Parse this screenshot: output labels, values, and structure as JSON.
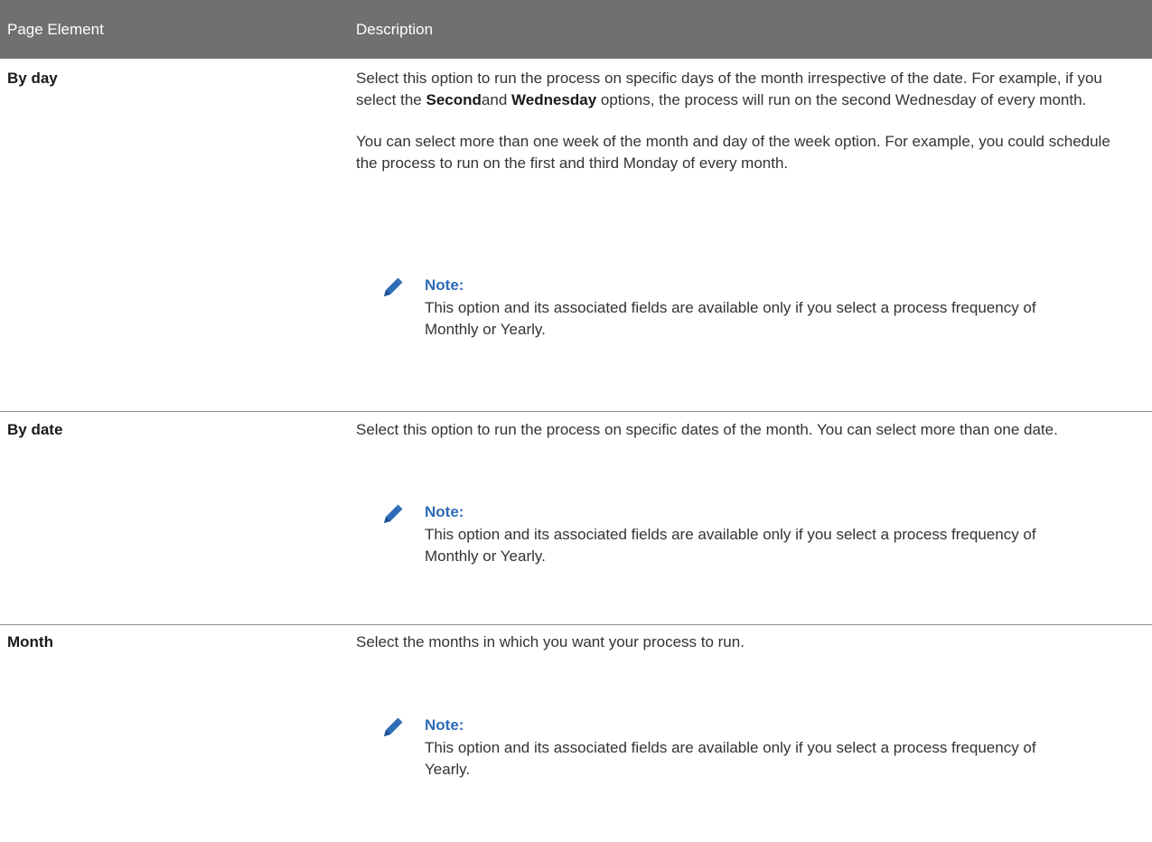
{
  "table": {
    "headers": [
      "Page Element",
      "Description"
    ],
    "rows": [
      {
        "term": "By day",
        "description_paragraphs": [
          {
            "before": "Select this option to run the process on specific days of the month irrespective of the date. For example, if you select the ",
            "bold1": "Second",
            "middle": "and ",
            "bold2": "Wednesday",
            "after": " options, the process will run on the second Wednesday of every month."
          },
          "You can select more than one week of the month and day of the week option. For example, you could schedule the process to run on the first and third Monday of every month."
        ],
        "note_label": "Note:",
        "note_text": "This option and its associated fields are available only if you select a process frequency of Monthly or Yearly."
      },
      {
        "term": "By date",
        "description": "Select this option to run the process on specific dates of the month. You can select more than one date.",
        "note_label": "Note:",
        "note_text": "This option and its associated fields are available only if you select a process frequency of Monthly or Yearly."
      },
      {
        "term": "Month",
        "description": "Select the months in which you want your process to run.",
        "note_label": "Note:",
        "note_text": "This option and its associated fields are available only if you select a process frequency of Yearly."
      }
    ]
  },
  "colors": {
    "header_bg": "#707070",
    "note_label": "#2f6bb5",
    "pencil_icon": "#2f6bb5",
    "divider": "#8a8a8a"
  }
}
